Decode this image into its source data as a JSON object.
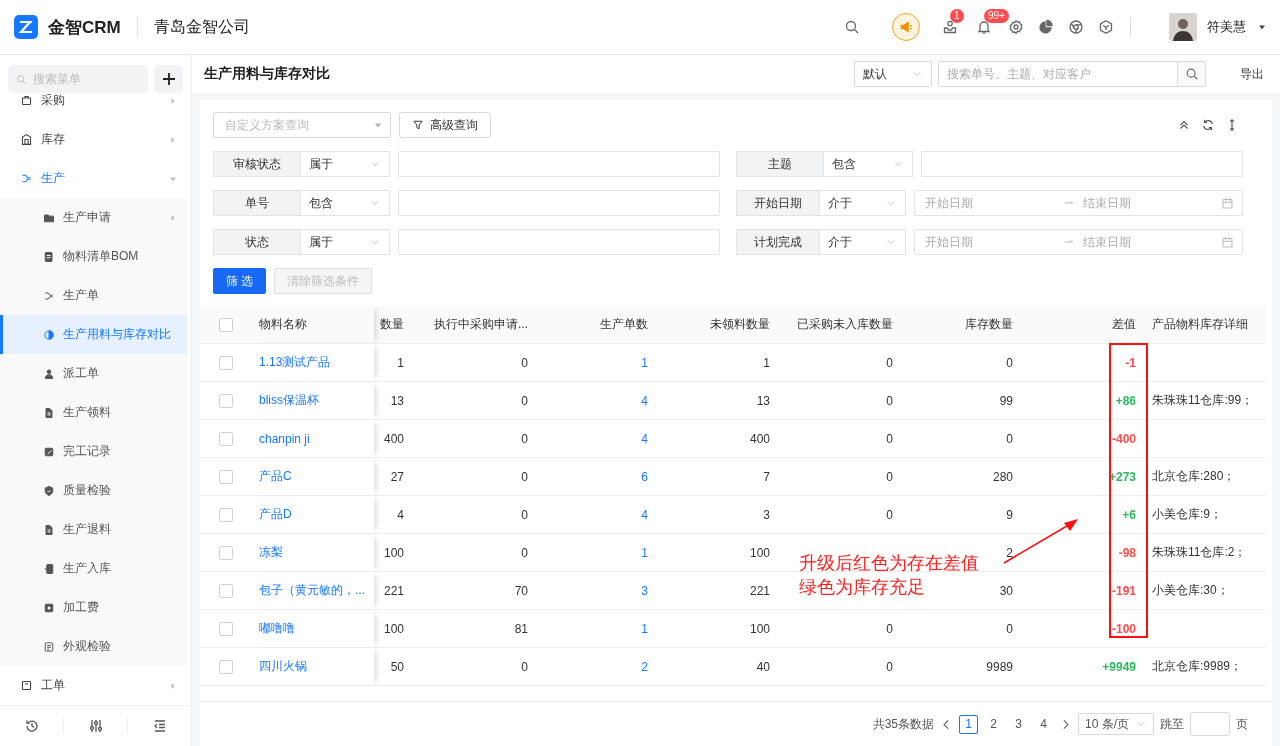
{
  "header": {
    "brand": "金智CRM",
    "company": "青岛金智公司",
    "badges": [
      "1",
      "99+"
    ],
    "user": "符美慧"
  },
  "sidebar": {
    "search_placeholder": "搜索菜单",
    "items": [
      {
        "label": "采购",
        "expanded": false
      },
      {
        "label": "库存",
        "expanded": false
      },
      {
        "label": "生产",
        "expanded": true,
        "children": [
          {
            "label": "生产申请",
            "expanded": false,
            "selected": false
          },
          {
            "label": "物料清单BOM",
            "selected": false
          },
          {
            "label": "生产单",
            "selected": false
          },
          {
            "label": "生产用料与库存对比",
            "selected": true
          },
          {
            "label": "派工单",
            "selected": false
          },
          {
            "label": "生产领料",
            "selected": false
          },
          {
            "label": "完工记录",
            "selected": false
          },
          {
            "label": "质量检验",
            "selected": false
          },
          {
            "label": "生产退料",
            "selected": false
          },
          {
            "label": "生产入库",
            "selected": false
          },
          {
            "label": "加工费",
            "selected": false
          },
          {
            "label": "外观检验",
            "selected": false
          }
        ]
      },
      {
        "label": "工单",
        "expanded": false
      }
    ]
  },
  "page": {
    "title": "生产用料与库存对比",
    "view_select": "默认",
    "search_placeholder": "搜索单号、主题、对应客户",
    "export": "导出"
  },
  "filters": {
    "scheme_placeholder": "自定义方案查询",
    "advanced": "高级查询",
    "rows": [
      {
        "label": "审核状态",
        "operator": "属于",
        "kind": "text"
      },
      {
        "label": "主题",
        "operator": "包含",
        "kind": "text"
      },
      {
        "label": "单号",
        "operator": "包含",
        "kind": "text"
      },
      {
        "label": "开始日期",
        "operator": "介于",
        "kind": "date_range",
        "start_placeholder": "开始日期",
        "end_placeholder": "结束日期"
      },
      {
        "label": "状态",
        "operator": "属于",
        "kind": "text"
      },
      {
        "label": "计划完成",
        "operator": "介于",
        "kind": "date_range",
        "start_placeholder": "开始日期",
        "end_placeholder": "结束日期"
      }
    ],
    "buttons": [
      {
        "label": "筛 选",
        "kind": "primary",
        "disabled": false
      },
      {
        "label": "清除筛选条件",
        "kind": "default",
        "disabled": true
      }
    ]
  },
  "table": {
    "all_checked": false,
    "columns": [
      "物料名称",
      "数量",
      "执行中采购申请...",
      "生产单数",
      "未领料数量",
      "已采购未入库数量",
      "库存数量",
      "差值",
      "产品物料库存详细"
    ],
    "rows": [
      {
        "checked": false,
        "name": "1.13测试产品",
        "quantity": "1",
        "in_purchase": "0",
        "orders": "1",
        "unclaimed": "1",
        "purchased_pending": "0",
        "stock": "0",
        "difference": "-1",
        "color": "#ff4d4f"
      },
      {
        "checked": false,
        "name": "bliss保温杯",
        "quantity": "13",
        "in_purchase": "0",
        "orders": "4",
        "unclaimed": "13",
        "purchased_pending": "0",
        "stock": "99",
        "difference": "+86",
        "color": "#2db95f",
        "detail": "朱珠珠11仓库:99；"
      },
      {
        "checked": false,
        "name": "chanpin ji",
        "quantity": "400",
        "in_purchase": "0",
        "orders": "4",
        "unclaimed": "400",
        "purchased_pending": "0",
        "stock": "0",
        "difference": "-400",
        "color": "#ff4d4f"
      },
      {
        "checked": false,
        "name": "产品C",
        "quantity": "27",
        "in_purchase": "0",
        "orders": "6",
        "unclaimed": "7",
        "purchased_pending": "0",
        "stock": "280",
        "difference": "+273",
        "color": "#2db95f",
        "detail": "北京仓库:280；"
      },
      {
        "checked": false,
        "name": "产品D",
        "quantity": "4",
        "in_purchase": "0",
        "orders": "4",
        "unclaimed": "3",
        "purchased_pending": "0",
        "stock": "9",
        "difference": "+6",
        "color": "#2db95f",
        "detail": "小美仓库:9；"
      },
      {
        "checked": false,
        "name": "冻梨",
        "quantity": "100",
        "in_purchase": "0",
        "orders": "1",
        "unclaimed": "100",
        "stock": "2",
        "difference": "-98",
        "color": "#ff4d4f",
        "detail": "朱珠珠11仓库:2；"
      },
      {
        "checked": false,
        "name": "包子（黄元敏的，...",
        "quantity": "221",
        "in_purchase": "70",
        "orders": "3",
        "unclaimed": "221",
        "stock": "30",
        "difference": "-191",
        "color": "#ff4d4f",
        "detail": "小美仓库:30；"
      },
      {
        "checked": false,
        "name": "嘟噜噜",
        "quantity": "100",
        "in_purchase": "81",
        "orders": "1",
        "unclaimed": "100",
        "purchased_pending": "0",
        "stock": "0",
        "difference": "-100",
        "color": "#ff4d4f"
      },
      {
        "checked": false,
        "name": "四川火锅",
        "quantity": "50",
        "in_purchase": "0",
        "orders": "2",
        "unclaimed": "40",
        "purchased_pending": "0",
        "stock": "9989",
        "difference": "+9949",
        "color": "#2db95f",
        "detail": "北京仓库:9989；"
      }
    ]
  },
  "annotation": {
    "lines": [
      "升级后红色为存在差值",
      "绿色为库存充足"
    ]
  },
  "pagination": {
    "total": "共35条数据",
    "pages": [
      {
        "label": "1",
        "selected": true
      },
      {
        "label": "2",
        "selected": false
      },
      {
        "label": "3",
        "selected": false
      },
      {
        "label": "4",
        "selected": false
      }
    ],
    "page_size": "10 条/页",
    "jump_label": "跳至",
    "page_suffix": "页"
  }
}
